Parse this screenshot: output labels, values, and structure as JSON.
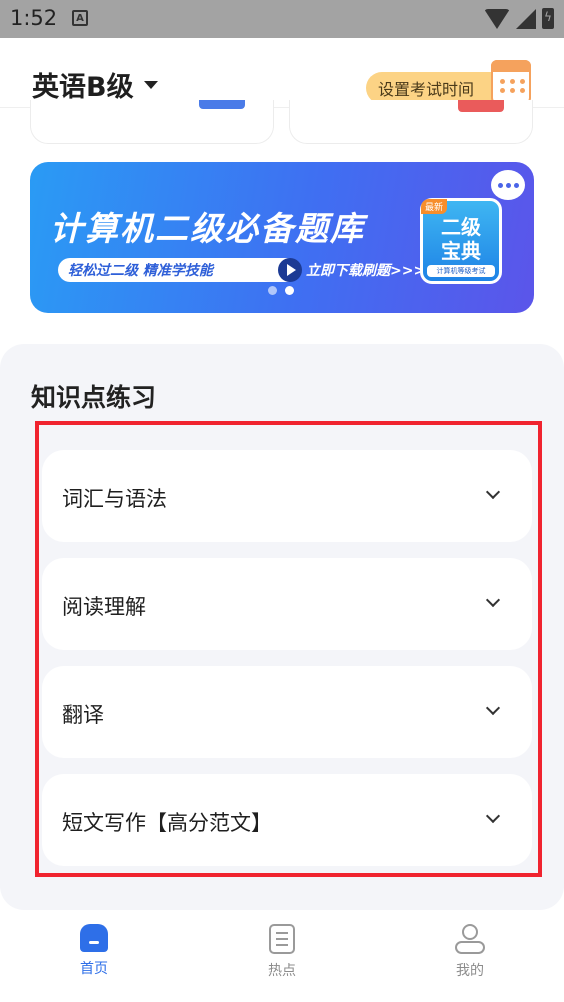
{
  "status_bar": {
    "time": "1:52",
    "notification_icon": "A"
  },
  "header": {
    "subject": "英语B级",
    "set_exam_time": "设置考试时间"
  },
  "banner": {
    "title": "计算机二级必备题库",
    "tagline": "轻松过二级 精准学技能",
    "download": "立即下载刷题>>>",
    "book_badge": "最新",
    "book_line1": "二级",
    "book_line2": "宝典",
    "book_footer": "计算机等级考试",
    "page_count": 2,
    "active_page": 2
  },
  "knowledge": {
    "title": "知识点练习",
    "topics": [
      {
        "label": "词汇与语法"
      },
      {
        "label": "阅读理解"
      },
      {
        "label": "翻译"
      },
      {
        "label": "短文写作【高分范文】"
      }
    ]
  },
  "tabbar": {
    "home": "首页",
    "hot": "热点",
    "me": "我的"
  },
  "colors": {
    "accent": "#2e6fe8",
    "highlight_border": "#f0232f",
    "exam_time_bg": "#fcd385"
  }
}
